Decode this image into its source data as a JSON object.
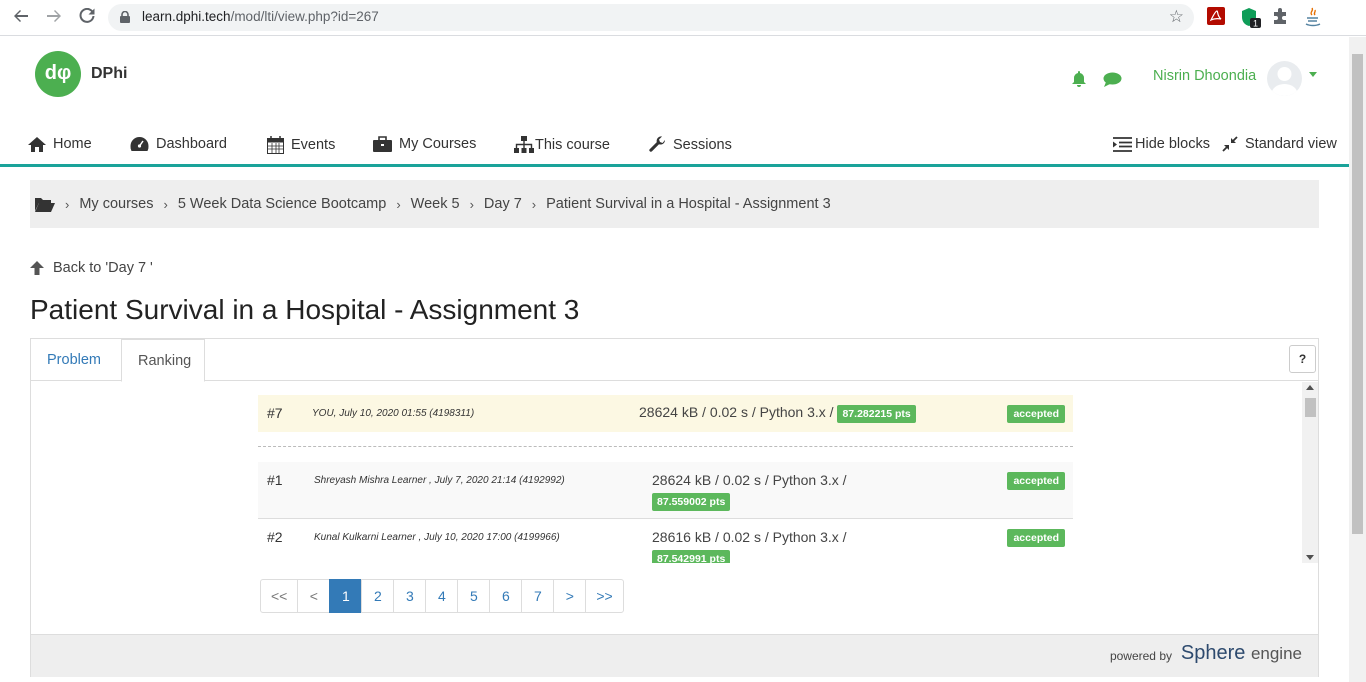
{
  "browser": {
    "url_host": "learn.dphi.tech",
    "url_path": "/mod/lti/view.php?id=267",
    "ext_badge": "1"
  },
  "header": {
    "logo_glyph": "dφ",
    "logo_text": "DPhi",
    "user_name": "Nisrin Dhoondia",
    "brand_color": "#4caf50",
    "accent_color": "#1aa39a"
  },
  "nav": {
    "home": "Home",
    "dashboard": "Dashboard",
    "events": "Events",
    "my_courses": "My Courses",
    "this_course": "This course",
    "sessions": "Sessions",
    "hide_blocks": "Hide blocks",
    "standard_view": "Standard view"
  },
  "breadcrumb": {
    "items": [
      "My courses",
      "5 Week Data Science Bootcamp",
      "Week 5",
      "Day 7",
      "Patient Survival in a Hospital - Assignment 3"
    ]
  },
  "back_link": "Back to 'Day 7 '",
  "page_title": "Patient Survival in a Hospital - Assignment 3",
  "tabs": {
    "problem": "Problem",
    "ranking": "Ranking",
    "help": "?"
  },
  "ranking": {
    "you": {
      "rank": "#7",
      "who": "YOU, July 10, 2020 01:55 (4198311)",
      "stats": "28624 kB / 0.02 s / Python 3.x /",
      "pts": "87.282215 pts",
      "status": "accepted"
    },
    "rows": [
      {
        "rank": "#1",
        "who": "Shreyash Mishra Learner , July 7, 2020 21:14 (4192992)",
        "stats": "28624 kB / 0.02 s / Python 3.x /",
        "pts": "87.559002 pts",
        "status": "accepted"
      },
      {
        "rank": "#2",
        "who": "Kunal Kulkarni Learner , July 10, 2020 17:00 (4199966)",
        "stats": "28616 kB / 0.02 s / Python 3.x /",
        "pts": "87.542991 pts",
        "status": "accepted"
      }
    ]
  },
  "pagination": {
    "first": "<<",
    "prev": "<",
    "pages": [
      "1",
      "2",
      "3",
      "4",
      "5",
      "6",
      "7"
    ],
    "current": "1",
    "next": ">",
    "last": ">>"
  },
  "footer": {
    "powered_by": "powered by",
    "logo_mark": "S",
    "logo_main": "phere",
    "logo_suffix": "engine"
  }
}
